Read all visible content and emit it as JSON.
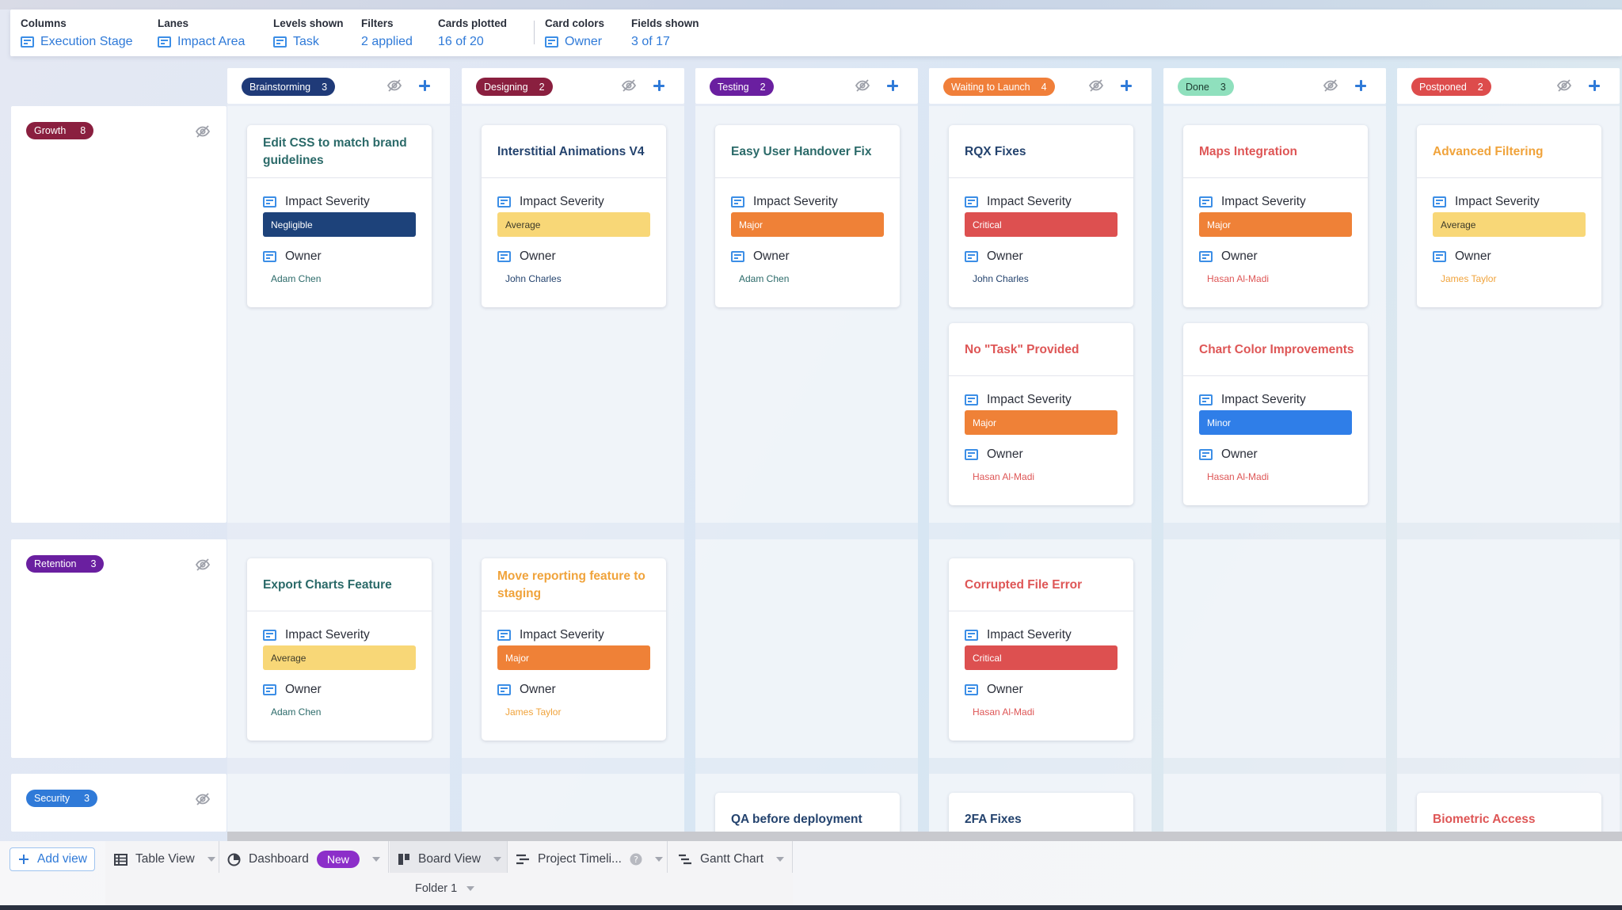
{
  "config": {
    "columns": {
      "label": "Columns",
      "value": "Execution Stage"
    },
    "lanes": {
      "label": "Lanes",
      "value": "Impact Area"
    },
    "levels_shown": {
      "label": "Levels shown",
      "value": "Task"
    },
    "filters": {
      "label": "Filters",
      "value": "2 applied"
    },
    "cards_plotted": {
      "label": "Cards plotted",
      "value": "16 of 20"
    },
    "card_colors": {
      "label": "Card colors",
      "value": "Owner"
    },
    "fields_shown": {
      "label": "Fields shown",
      "value": "3 of 17"
    }
  },
  "columns": [
    {
      "name": "Brainstorming",
      "count": "3",
      "bg": "#1f3a78",
      "fg": "#ffffff"
    },
    {
      "name": "Designing",
      "count": "2",
      "bg": "#8a1f3f",
      "fg": "#ffffff"
    },
    {
      "name": "Testing",
      "count": "2",
      "bg": "#6a1fa0",
      "fg": "#ffffff"
    },
    {
      "name": "Waiting to Launch",
      "count": "4",
      "bg": "#f07f3a",
      "fg": "#ffffff"
    },
    {
      "name": "Done",
      "count": "3",
      "bg": "#8fe0bd",
      "fg": "#1d3b30"
    },
    {
      "name": "Postponed",
      "count": "2",
      "bg": "#dd4c4c",
      "fg": "#ffffff"
    }
  ],
  "lanes": [
    {
      "name": "Growth",
      "count": "8",
      "bg": "#8a1f3f"
    },
    {
      "name": "Retention",
      "count": "3",
      "bg": "#6a1fa0"
    },
    {
      "name": "Security",
      "count": "3",
      "bg": "#2f7ad8"
    }
  ],
  "field_labels": {
    "severity": "Impact Severity",
    "owner": "Owner"
  },
  "cards": [
    {
      "title": "Edit CSS to match brand guidelines",
      "severity": "Negligible",
      "owner": "Adam Chen",
      "title_color": "#2b6a69",
      "owner_color": "#2b6a69",
      "sev_bg": "#1d427a",
      "sev_fg": "#ffffff"
    },
    {
      "title": "Interstitial Animations V4",
      "severity": "Average",
      "owner": "John Charles",
      "title_color": "#24436e",
      "owner_color": "#24436e",
      "sev_bg": "#f8d777",
      "sev_fg": "#3c3a2a"
    },
    {
      "title": "Easy User Handover Fix",
      "severity": "Major",
      "owner": "Adam Chen",
      "title_color": "#2b6a69",
      "owner_color": "#2b6a69",
      "sev_bg": "#ef8137",
      "sev_fg": "#ffffff"
    },
    {
      "title": "RQX Fixes",
      "severity": "Critical",
      "owner": "John Charles",
      "title_color": "#24436e",
      "owner_color": "#24436e",
      "sev_bg": "#dd5050",
      "sev_fg": "#ffffff"
    },
    {
      "title": "Maps Integration",
      "severity": "Major",
      "owner": "Hasan Al-Madi",
      "title_color": "#de5656",
      "owner_color": "#de5656",
      "sev_bg": "#ef8137",
      "sev_fg": "#ffffff"
    },
    {
      "title": "Advanced Filtering",
      "severity": "Average",
      "owner": "James Taylor",
      "title_color": "#f0a33b",
      "owner_color": "#f0a33b",
      "sev_bg": "#f8d777",
      "sev_fg": "#3c3a2a"
    },
    {
      "title": "No \"Task\" Provided",
      "severity": "Major",
      "owner": "Hasan Al-Madi",
      "title_color": "#de5656",
      "owner_color": "#de5656",
      "sev_bg": "#ef8137",
      "sev_fg": "#ffffff"
    },
    {
      "title": "Chart Color Improvements",
      "severity": "Minor",
      "owner": "Hasan Al-Madi",
      "title_color": "#de5656",
      "owner_color": "#de5656",
      "sev_bg": "#2f7ee8",
      "sev_fg": "#ffffff"
    },
    {
      "title": "Export Charts Feature",
      "severity": "Average",
      "owner": "Adam Chen",
      "title_color": "#2b6a69",
      "owner_color": "#2b6a69",
      "sev_bg": "#f8d777",
      "sev_fg": "#3c3a2a"
    },
    {
      "title": "Move reporting feature to staging",
      "severity": "Major",
      "owner": "James Taylor",
      "title_color": "#f0a33b",
      "owner_color": "#f0a33b",
      "sev_bg": "#ef8137",
      "sev_fg": "#ffffff"
    },
    {
      "title": "Corrupted File Error",
      "severity": "Critical",
      "owner": "Hasan Al-Madi",
      "title_color": "#de5656",
      "owner_color": "#de5656",
      "sev_bg": "#dd5050",
      "sev_fg": "#ffffff"
    },
    {
      "title": "QA before deployment",
      "title_color": "#24436e"
    },
    {
      "title": "2FA Fixes",
      "title_color": "#24436e"
    },
    {
      "title": "Biometric Access",
      "title_color": "#de5656"
    }
  ],
  "tabs": {
    "add_view": "Add view",
    "table_view": "Table View",
    "dashboard": "Dashboard",
    "new_badge": "New",
    "board_view": "Board View",
    "project_timeline": "Project Timeli...",
    "gantt_chart": "Gantt Chart",
    "folder": "Folder 1"
  },
  "icons": {
    "field": "field-icon",
    "hide": "eye-slash-icon",
    "add": "plus-icon",
    "help": "help-icon"
  }
}
